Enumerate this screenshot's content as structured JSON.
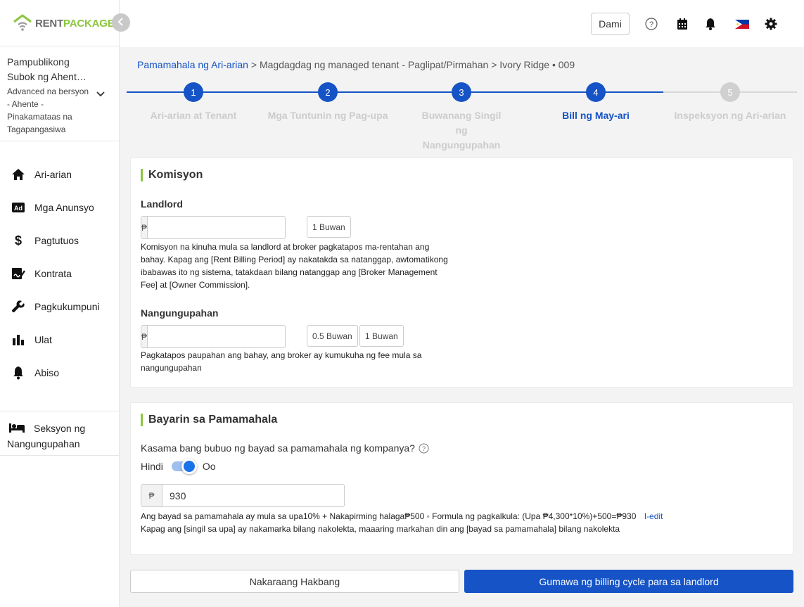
{
  "brand": {
    "name_part1": "RENT",
    "name_part2": "PACKAGE",
    "color": "#8cc63f"
  },
  "account": {
    "name": "Pampublikong Subok ng Ahent…",
    "plan": "Advanced na bersyon - Ahente - Pinakamataas na Tagapangasiwa"
  },
  "sidebar": {
    "items": [
      {
        "label": "Ari-arian",
        "icon": "home-icon"
      },
      {
        "label": "Mga Anunsyo",
        "icon": "ad-icon"
      },
      {
        "label": "Pagtutuos",
        "icon": "dollar-icon"
      },
      {
        "label": "Kontrata",
        "icon": "contract-icon"
      },
      {
        "label": "Pagkukumpuni",
        "icon": "wrench-icon"
      },
      {
        "label": "Ulat",
        "icon": "bar-chart-icon"
      },
      {
        "label": "Abiso",
        "icon": "bell-icon"
      }
    ],
    "tenant_section": "Seksyon ng Nangungupahan"
  },
  "header": {
    "dami_label": "Dami"
  },
  "breadcrumb": {
    "root": "Pamamahala ng Ari-arian",
    "sep1": ">",
    "middle": "Magdagdag ng managed tenant - Paglipat/Pirmahan",
    "sep2": ">",
    "current": "Ivory Ridge • 009"
  },
  "steps": [
    {
      "number": "1",
      "label": "Ari-arian at Tenant",
      "state": "done"
    },
    {
      "number": "2",
      "label": "Mga Tuntunin ng Pag-upa",
      "state": "done"
    },
    {
      "number": "3",
      "label": "Buwanang Singil ng Nangungupahan",
      "state": "done"
    },
    {
      "number": "4",
      "label": "Bill ng May-ari",
      "state": "active"
    },
    {
      "number": "5",
      "label": "Inspeksyon ng Ari-arian",
      "state": "pending"
    }
  ],
  "commission": {
    "title": "Komisyon",
    "landlord": {
      "label": "Landlord",
      "currency": "₱",
      "value": "",
      "chip": "1 Buwan",
      "help": "Komisyon na kinuha mula sa landlord at broker pagkatapos ma-rentahan ang bahay. Kapag ang [Rent Billing Period] ay nakatakda sa natanggap, awtomatikong ibabawas ito ng sistema, tatakdaan bilang natanggap ang [Broker Management Fee] at [Owner Commission]."
    },
    "tenant": {
      "label": "Nangungupahan",
      "currency": "₱",
      "value": "",
      "chip1": "0.5 Buwan",
      "chip2": "1 Buwan",
      "help": "Pagkatapos paupahan ang bahay, ang broker ay kumukuha ng fee mula sa nangungupahan"
    }
  },
  "management": {
    "title": "Bayarin sa Pamamahala",
    "question": "Kasama bang bubuo ng bayad sa pamamahala ng kompanya?",
    "toggle_off": "Hindi",
    "toggle_on": "Oo",
    "toggle_state": "on",
    "currency": "₱",
    "value": "930",
    "info": "Ang bayad sa pamamahala ay mula sa upa10% + Nakapirming halaga₱500 ◦ Formula ng pagkalkula: (Upa ₱4,300*10%)+500=₱930",
    "edit_link": "I-edit",
    "note": "Kapag ang [singil sa upa] ay nakamarka bilang nakolekta, maaaring markahan din ang [bayad sa pamamahala] bilang nakolekta"
  },
  "footer": {
    "prev_label": "Nakaraang Hakbang",
    "submit_label": "Gumawa ng billing cycle para sa landlord"
  },
  "colors": {
    "primary": "#1553c6",
    "accent": "#8cc63f",
    "step_pending": "#d0d0d0"
  }
}
